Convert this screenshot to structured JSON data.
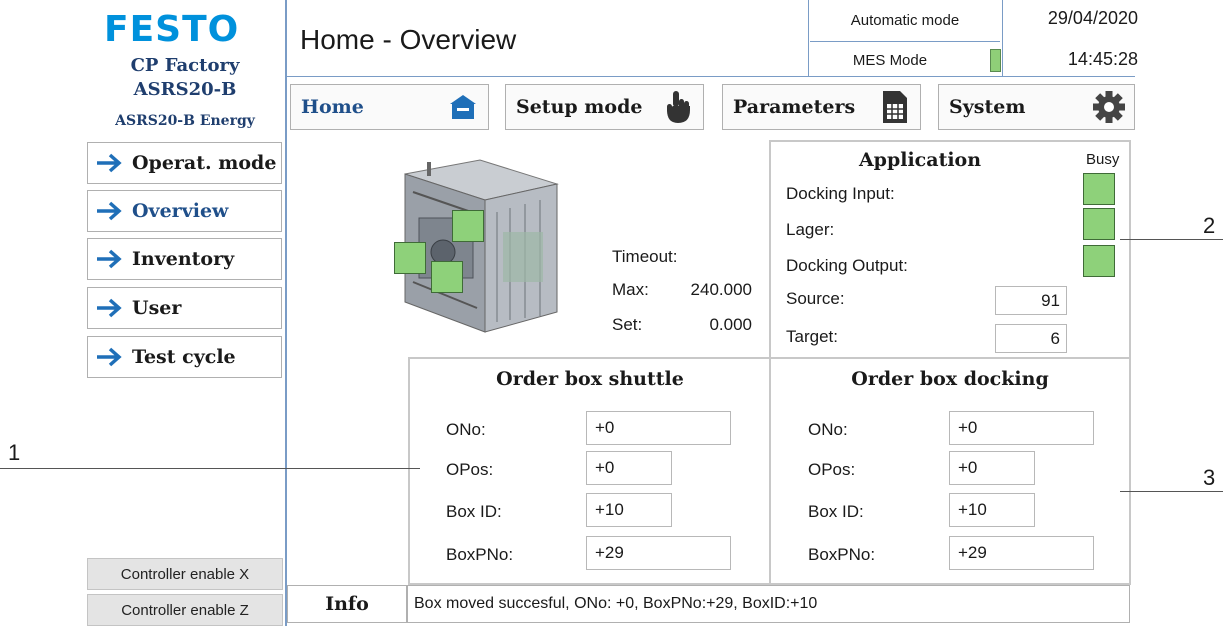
{
  "brand": {
    "logo": "FESTO",
    "line1": "CP Factory",
    "line2": "ASRS20-B",
    "line3": "ASRS20-B Energy"
  },
  "header": {
    "title": "Home - Overview",
    "mode": "Automatic mode",
    "mes_mode": "MES Mode",
    "mes_indicator_color": "#8fcf78",
    "date": "29/04/2020",
    "time": "14:45:28"
  },
  "tabs": [
    {
      "label": "Home",
      "icon": "home-icon",
      "active": true
    },
    {
      "label": "Setup mode",
      "icon": "hand-pointer-icon",
      "active": false
    },
    {
      "label": "Parameters",
      "icon": "document-icon",
      "active": false
    },
    {
      "label": "System",
      "icon": "gear-icon",
      "active": false
    }
  ],
  "sidebar": {
    "items": [
      {
        "label": "Operat. mode",
        "icon": "arrow-right-icon"
      },
      {
        "label": "Overview",
        "icon": "arrow-right-icon",
        "active": true
      },
      {
        "label": "Inventory",
        "icon": "arrow-right-icon"
      },
      {
        "label": "User",
        "icon": "arrow-right-icon"
      },
      {
        "label": "Test cycle",
        "icon": "arrow-right-icon"
      }
    ],
    "controller_x": "Controller enable X",
    "controller_z": "Controller enable Z"
  },
  "timeout": {
    "label": "Timeout:",
    "max_label": "Max:",
    "max_value": "240.000",
    "set_label": "Set:",
    "set_value": "0.000"
  },
  "application": {
    "title": "Application",
    "busy": "Busy",
    "docking_input": "Docking Input:",
    "lager": "Lager:",
    "docking_output": "Docking Output:",
    "source_label": "Source:",
    "source_value": "91",
    "target_label": "Target:",
    "target_value": "6",
    "status_color": "#8ed17a"
  },
  "shuttle": {
    "title": "Order box shuttle",
    "ono_label": "ONo:",
    "ono_value": "+0",
    "opos_label": "OPos:",
    "opos_value": "+0",
    "boxid_label": "Box ID:",
    "boxid_value": "+10",
    "boxpno_label": "BoxPNo:",
    "boxpno_value": "+29"
  },
  "docking": {
    "title": "Order box docking",
    "ono_label": "ONo:",
    "ono_value": "+0",
    "opos_label": "OPos:",
    "opos_value": "+0",
    "boxid_label": "Box ID:",
    "boxid_value": "+10",
    "boxpno_label": "BoxPNo:",
    "boxpno_value": "+29"
  },
  "callouts": {
    "c1": "1",
    "c2": "2",
    "c3": "3"
  },
  "info": {
    "label": "Info",
    "text": "Box moved succesful, ONo: +0, BoxPNo:+29, BoxID:+10"
  }
}
